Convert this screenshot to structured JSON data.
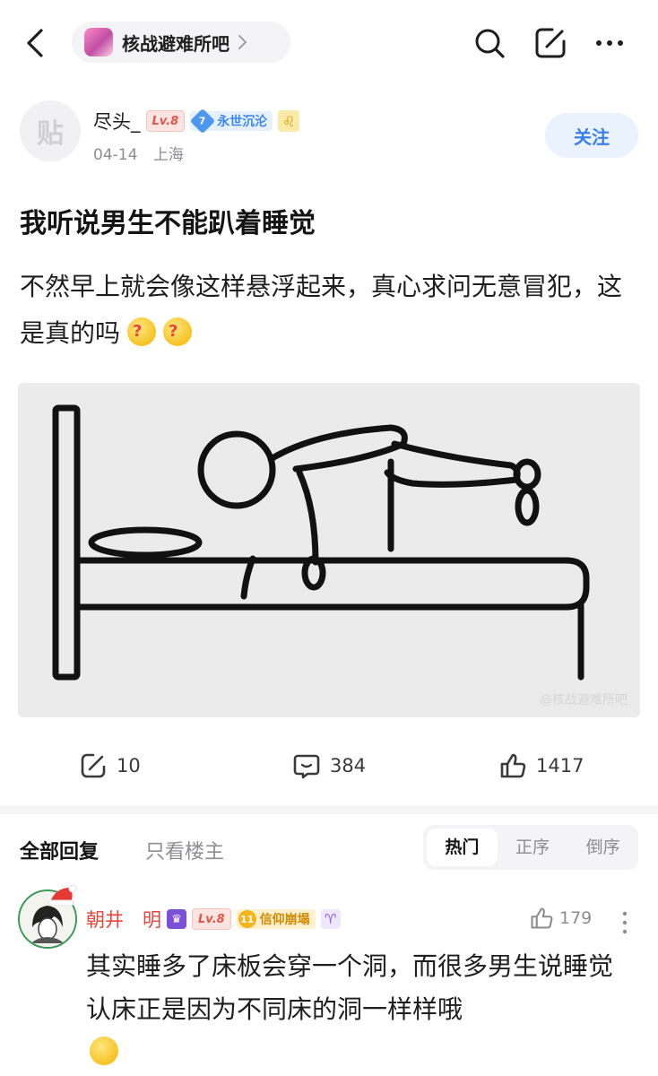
{
  "header": {
    "forum_name": "核战避难所吧"
  },
  "author": {
    "avatar_text": "贴",
    "name": "尽头_",
    "level": "Lv.8",
    "title_level": "7",
    "title": "永世沉沦",
    "zodiac": "♌",
    "date": "04-14",
    "location": "上海",
    "follow_label": "关注"
  },
  "post": {
    "title": "我听说男生不能趴着睡觉",
    "body": "不然早上就会像这样悬浮起来，真心求问无意冒犯，这是真的吗",
    "image_watermark": "@核战避难所吧"
  },
  "actions": {
    "share_count": "10",
    "comment_count": "384",
    "like_count": "1417"
  },
  "replies": {
    "tab_all": "全部回复",
    "tab_op_only": "只看楼主",
    "sort_hot": "热门",
    "sort_asc": "正序",
    "sort_desc": "倒序"
  },
  "comment": {
    "name": "朝井　明",
    "level": "Lv.8",
    "title_level": "11",
    "title": "信仰崩塌",
    "zodiac": "♈",
    "like_count": "179",
    "text": "其实睡多了床板会穿一个洞，而很多男生说睡觉认床正是因为不同床的洞一样样哦"
  },
  "colors": {
    "accent_blue": "#3a7ee8",
    "level_red": "#e2554a",
    "name_red": "#e8453c"
  }
}
